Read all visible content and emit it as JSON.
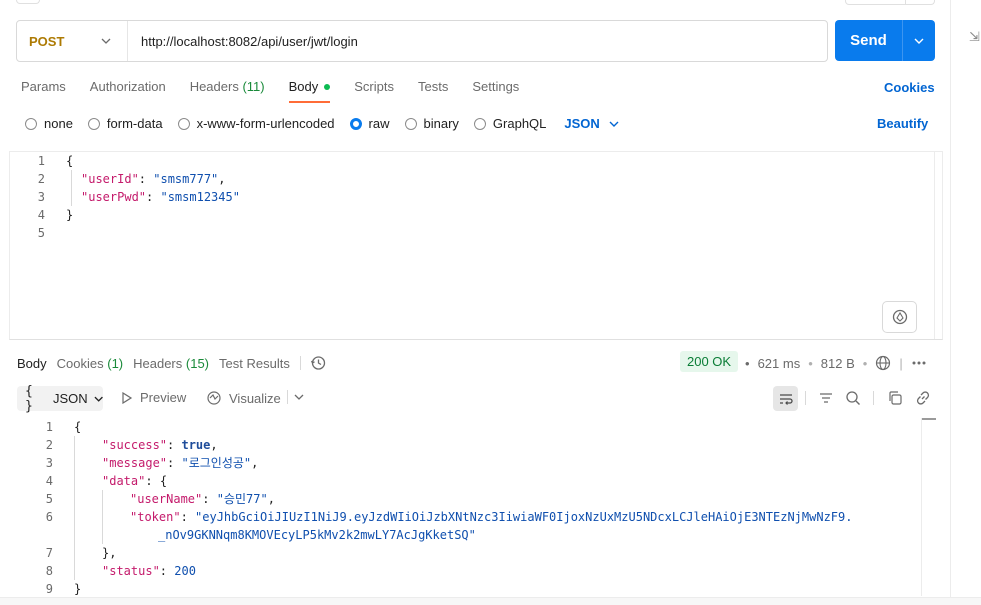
{
  "request": {
    "method": "POST",
    "url": "http://localhost:8082/api/user/jwt/login",
    "send_label": "Send"
  },
  "request_tabs": [
    {
      "label": "Params"
    },
    {
      "label": "Authorization"
    },
    {
      "label": "Headers",
      "count": "(11)"
    },
    {
      "label": "Body"
    },
    {
      "label": "Scripts"
    },
    {
      "label": "Tests"
    },
    {
      "label": "Settings"
    }
  ],
  "cookies_label": "Cookies",
  "body_types": [
    "none",
    "form-data",
    "x-www-form-urlencoded",
    "raw",
    "binary",
    "GraphQL"
  ],
  "body_type_selected": "raw",
  "body_format": "JSON",
  "beautify_label": "Beautify",
  "request_body_lines": {
    "l1": "{",
    "l2_key": "\"userId\"",
    "l2_val": "\"smsm777\"",
    "l3_key": "\"userPwd\"",
    "l3_val": "\"smsm12345\"",
    "l4": "}",
    "line_numbers": [
      "1",
      "2",
      "3",
      "4",
      "5"
    ]
  },
  "response_tabs": [
    {
      "label": "Body"
    },
    {
      "label": "Cookies",
      "count": "(1)"
    },
    {
      "label": "Headers",
      "count": "(15)"
    },
    {
      "label": "Test Results"
    }
  ],
  "response_meta": {
    "status": "200 OK",
    "time": "621 ms",
    "size": "812 B"
  },
  "response_toolbar": {
    "format": "JSON",
    "preview": "Preview",
    "visualize": "Visualize"
  },
  "response_body": {
    "line_numbers": [
      "1",
      "2",
      "3",
      "4",
      "5",
      "6",
      "",
      "7",
      "8",
      "9"
    ],
    "open": "{",
    "success_key": "\"success\"",
    "success_val": "true",
    "message_key": "\"message\"",
    "message_val": "\"로그인성공\"",
    "data_key": "\"data\"",
    "data_open": "{",
    "username_key": "\"userName\"",
    "username_val": "\"승민77\"",
    "token_key": "\"token\"",
    "token_val_1": "\"eyJhbGciOiJIUzI1NiJ9.eyJzdWIiOiJzbXNtNzc3IiwiaWF0IjoxNzUxMzU5NDcxLCJleHAiOjE3NTEzNjMwNzF9.",
    "token_val_2": "_nOv9GKNNqm8KMOVEcyLP5kMv2k2mwLY7AcJgKketSQ\"",
    "data_close": "},",
    "status_key": "\"status\"",
    "status_val": "200",
    "close": "}"
  },
  "colors": {
    "method": "#ad7a03",
    "send": "#097bed",
    "link": "#0265d2",
    "active_tab_underline": "#ff6c37",
    "status_ok": "#0a7d36",
    "json_key": "#c41a6b",
    "json_string": "#0f4fae"
  }
}
